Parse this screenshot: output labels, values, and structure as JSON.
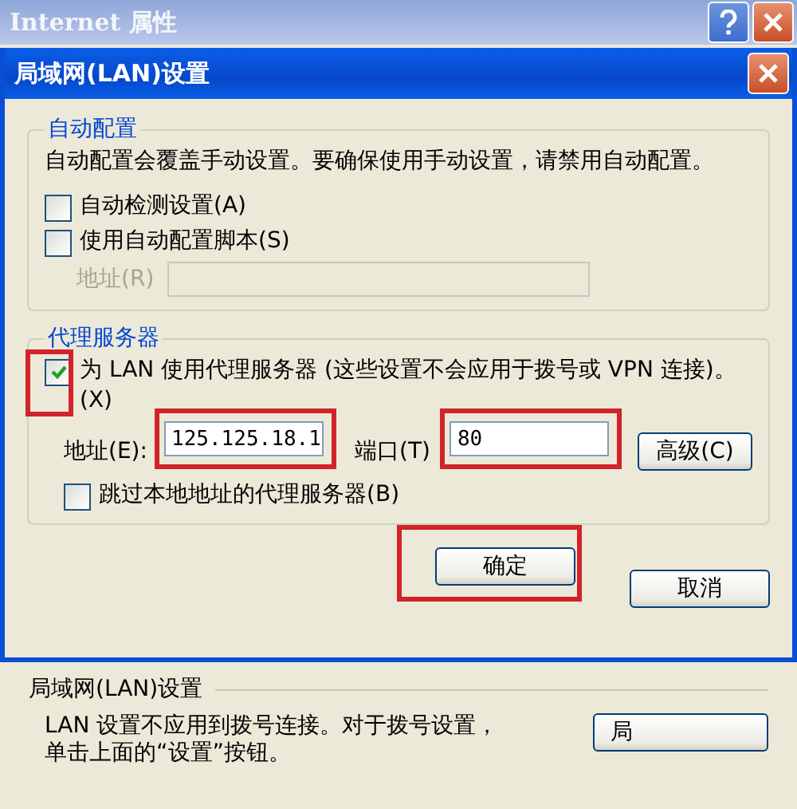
{
  "window": {
    "title": "Internet 属性"
  },
  "dialog": {
    "title": "局域网(LAN)设置",
    "auto_config": {
      "legend": "自动配置",
      "note": "自动配置会覆盖手动设置。要确保使用手动设置，请禁用自动配置。",
      "options": [
        {
          "label": "自动检测设置(A)",
          "checked": false
        },
        {
          "label": "使用自动配置脚本(S)",
          "checked": false
        }
      ],
      "address": {
        "label": "地址(R)",
        "disabled": true
      }
    },
    "proxy": {
      "legend": "代理服务器",
      "use_proxy": {
        "label": "为 LAN 使用代理服务器 (这些设置不会应用于拨号或 VPN 连接)。(X)",
        "checked": true,
        "highlighted": true
      },
      "address": {
        "label": "地址(E):",
        "value": "125.125.18.1",
        "highlighted": true
      },
      "port": {
        "label": "端口(T)",
        "value": "80",
        "highlighted": true
      },
      "advanced_button": "高级(C)",
      "bypass": {
        "label": "跳过本地地址的代理服务器(B)",
        "checked": false
      }
    },
    "buttons": [
      {
        "label": "确定",
        "highlighted": true
      },
      {
        "label": "取消",
        "highlighted": false
      }
    ]
  },
  "background": {
    "legend": "局域网(LAN)设置",
    "note": "LAN 设置不应用到拨号连接。对于拨号设置，单击上面的“设置”按钮。",
    "button": "局"
  }
}
